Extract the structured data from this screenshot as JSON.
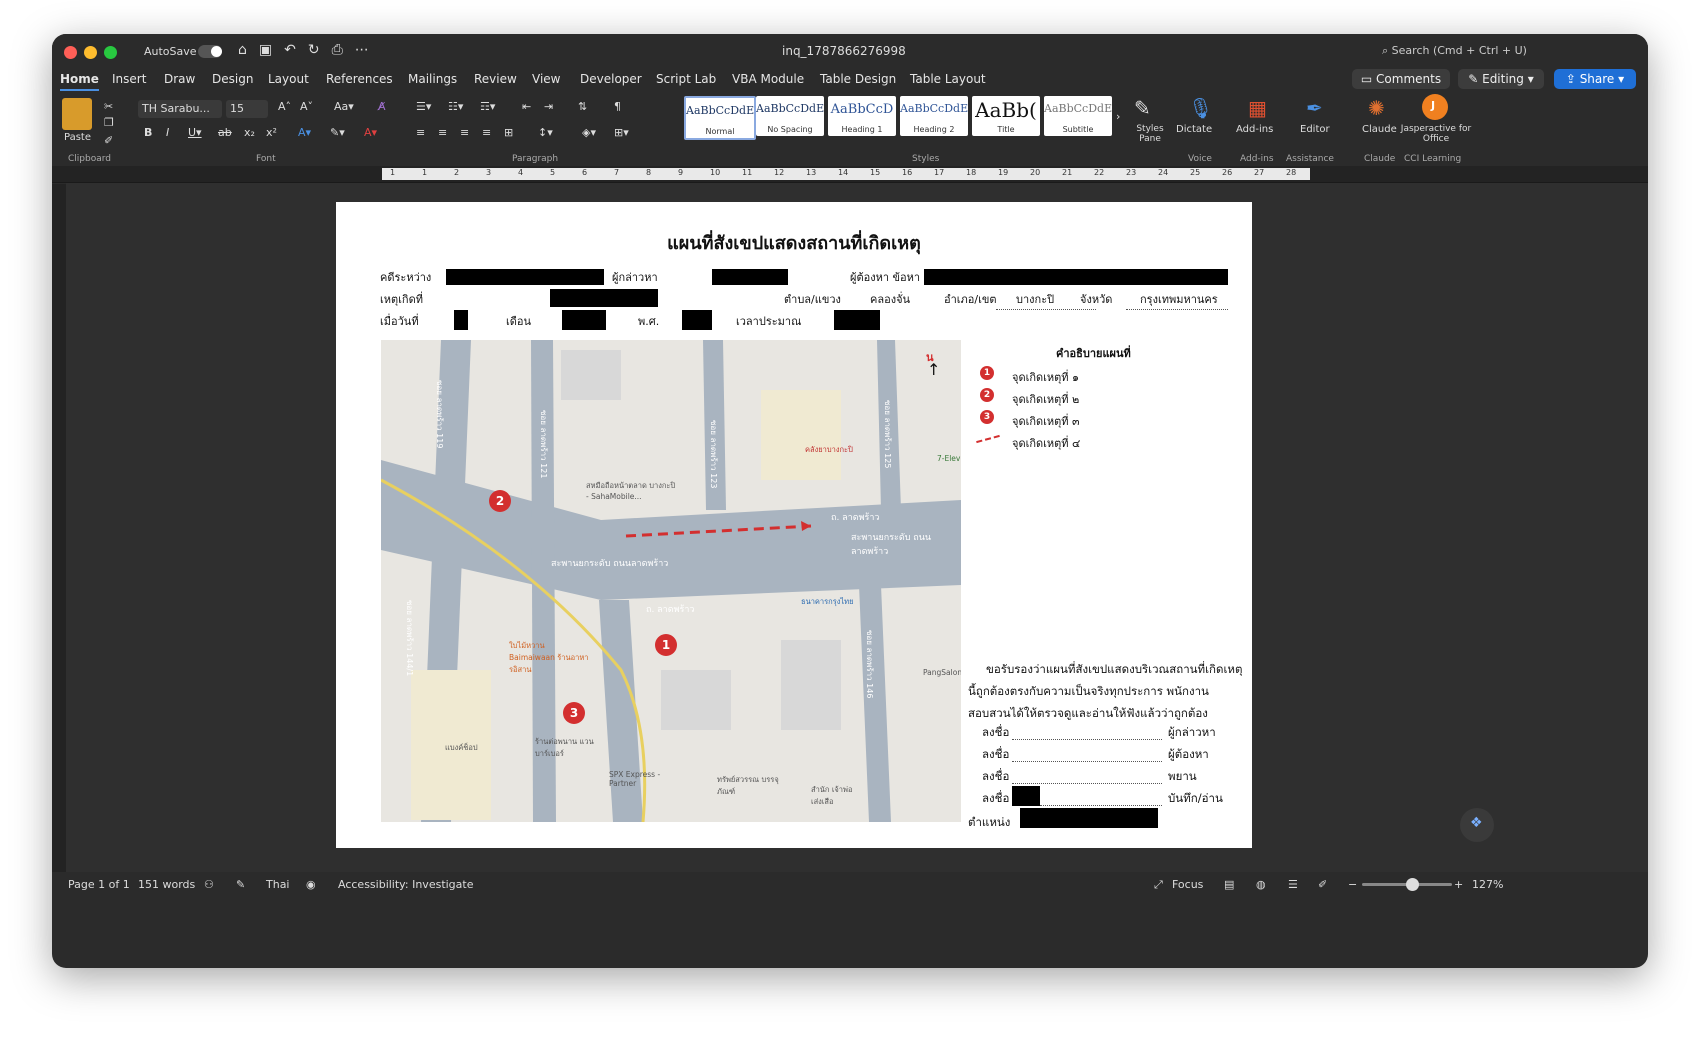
{
  "titlebar": {
    "autosave_label": "AutoSave",
    "document_title": "inq_1787866276998",
    "search_placeholder": "Search (Cmd + Ctrl + U)"
  },
  "tabs": [
    "Home",
    "Insert",
    "Draw",
    "Design",
    "Layout",
    "References",
    "Mailings",
    "Review",
    "View",
    "Developer",
    "Script Lab",
    "VBA Module",
    "Table Design",
    "Table Layout"
  ],
  "header_buttons": {
    "comments": "Comments",
    "editing": "Editing",
    "share": "Share"
  },
  "ribbon": {
    "paste_label": "Paste",
    "font_name": "TH Sarabu...",
    "font_size": "15",
    "group_labels": {
      "clipboard": "Clipboard",
      "font": "Font",
      "paragraph": "Paragraph",
      "styles": "Styles",
      "voice": "Voice",
      "addins": "Add-ins",
      "assistance": "Assistance",
      "claude": "Claude",
      "cci": "CCI Learning"
    },
    "styles": [
      {
        "sample": "AaBbCcDdEe",
        "name": "Normal"
      },
      {
        "sample": "AaBbCcDdEe",
        "name": "No Spacing"
      },
      {
        "sample": "AaBbCcD",
        "name": "Heading 1"
      },
      {
        "sample": "AaBbCcDdE",
        "name": "Heading 2"
      },
      {
        "sample": "AaBb(",
        "name": "Title"
      },
      {
        "sample": "AaBbCcDdE",
        "name": "Subtitle"
      }
    ],
    "styles_pane": "Styles Pane",
    "dictate": "Dictate",
    "addins": "Add-ins",
    "editor": "Editor",
    "claude": "Claude",
    "jasperactive": "Jasperactive for Office"
  },
  "ruler_numbers": [
    "1",
    "1",
    "2",
    "3",
    "4",
    "5",
    "6",
    "7",
    "8",
    "9",
    "10",
    "11",
    "12",
    "13",
    "14",
    "15",
    "16",
    "17",
    "18",
    "19",
    "20",
    "21",
    "22",
    "23",
    "24",
    "25",
    "26",
    "27",
    "28"
  ],
  "document": {
    "title": "แผนที่สังเขปแสดงสถานที่เกิดเหตุ",
    "row1": {
      "case_between": "คดีระหว่าง",
      "accuser": "ผู้กล่าวหา",
      "accused": "ผู้ต้องหา ข้อหา"
    },
    "row2": {
      "incident_at": "เหตุเกิดที่",
      "subdistrict_label": "ตำบล/แขวง",
      "subdistrict_value": "คลองจั่น",
      "district_label": "อำเภอ/เขต",
      "district_value": "บางกะปิ",
      "province_label": "จังหวัด",
      "province_value": "กรุงเทพมหานคร"
    },
    "row3": {
      "date_label": "เมื่อวันที่",
      "month_label": "เดือน",
      "year_label": "พ.ศ.",
      "time_label": "เวลาประมาณ"
    },
    "legend": {
      "title": "คำอธิบายแผนที่",
      "north": "น",
      "items": [
        {
          "num": "1",
          "label": "จุดเกิดเหตุที่ ๑"
        },
        {
          "num": "2",
          "label": "จุดเกิดเหตุที่ ๒"
        },
        {
          "num": "3",
          "label": "จุดเกิดเหตุที่ ๓"
        },
        {
          "num": "",
          "label": "จุดเกิดเหตุที่ ๔"
        }
      ]
    },
    "map": {
      "roads": [
        "ถ. ลาดพร้าว",
        "สะพานยกระดับ ถนนลาดพร้าว",
        "ซอย ลาดพร้าว 119",
        "ซอย ลาดพร้าว 121",
        "ซอย ลาดพร้าว 123",
        "ซอย ลาดพร้าว 125",
        "ซอย ลาดพร้าว 144/1",
        "ซอย ลาดพร้าว 146"
      ],
      "pois": [
        "สหมือถือหน้าตลาด บางกะปิ - SahaMobile...",
        "คลังยาบางกะปิ",
        "7-Elev",
        "ใบไม้หวาน Baimaiwaan ร้านอาหารอิสาน",
        "ร้านต่อพนาน แวนบาร์เบอร์",
        "แบงค์ช็อป",
        "SPX Express - Partner",
        "ทรัพย์สวรรณ บรรจุภัณฑ์",
        "สำนัก เจ้าพ่อเส่งเสือ",
        "PangSalon",
        "ธนาคารกรุงไทย"
      ],
      "markers": [
        "1",
        "2",
        "3"
      ]
    },
    "certify": {
      "paragraph": "ขอรับรองว่าแผนที่สังเขปแสดงบริเวณสถานที่เกิดเหตุนี้ถูกต้องตรงกับความเป็นจริงทุกประการ พนักงานสอบสวนได้ให้ตรวจดูและอ่านให้ฟังแล้วว่าถูกต้อง",
      "sign": "ลงชื่อ",
      "roles": [
        "ผู้กล่าวหา",
        "ผู้ต้องหา",
        "พยาน",
        "บันทึก/อ่าน"
      ],
      "position": "ตำแหน่ง"
    }
  },
  "statusbar": {
    "page": "Page 1 of 1",
    "words": "151 words",
    "language": "Thai",
    "accessibility": "Accessibility: Investigate",
    "focus": "Focus",
    "zoom": "127%"
  }
}
